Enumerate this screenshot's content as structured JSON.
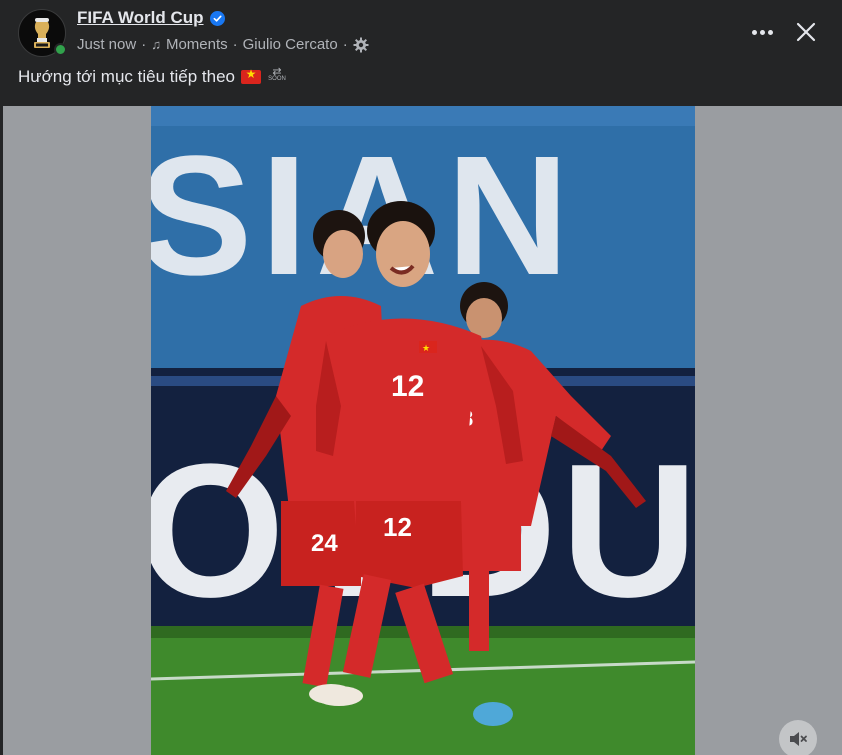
{
  "post": {
    "page_name": "FIFA World Cup",
    "timestamp": "Just now",
    "separator": "·",
    "category": "Moments",
    "author": "Giulio Cercato",
    "caption": "Hướng tới mục tiêu tiếp theo",
    "caption_emojis": [
      "vietnam-flag-icon",
      "soon-arrow-icon"
    ]
  },
  "photo": {
    "banner_top_text": "SIAN",
    "banner_bottom_text": "OVDUS",
    "jersey_number_front": "12",
    "jersey_number_back": "24",
    "jersey_number_right": "8",
    "colors": {
      "shirt": "#d42a2a",
      "banner_blue": "#2f6fa8",
      "banner_dark": "#13213f",
      "pitch": "#3f8a2c"
    }
  },
  "icons": {
    "verified": "verified-badge-icon",
    "music": "music-note-icon",
    "privacy": "gear-icon",
    "more": "more-options-icon",
    "close": "close-icon",
    "mute": "speaker-muted-icon"
  },
  "colors": {
    "background": "#242526",
    "text": "#e4e6eb",
    "secondary_text": "#b0b3b8",
    "verified_blue": "#1877f2",
    "online_green": "#31a24c"
  }
}
